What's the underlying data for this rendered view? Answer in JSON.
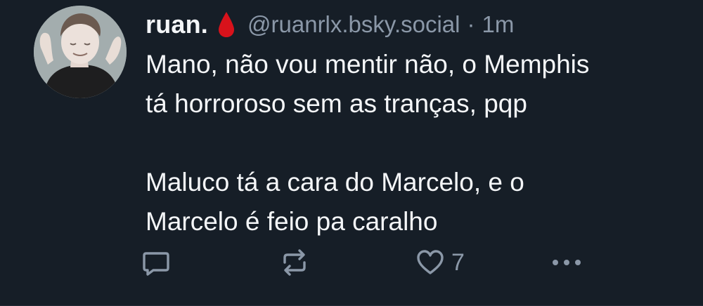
{
  "post": {
    "author": {
      "display_name": "ruan.",
      "handle": "@ruanrlx.bsky.social",
      "badge_icon": "blood-drop-icon",
      "badge_color": "#d8121b"
    },
    "separator": "·",
    "timestamp": "1m",
    "text": {
      "paragraph_1": "Mano, não vou mentir não, o Memphis\ntá horroroso sem as tranças, pqp",
      "paragraph_2": "Maluco tá a cara do Marcelo, e o\nMarcelo é feio pa caralho"
    },
    "actions": {
      "reply_icon": "reply-icon",
      "repost_icon": "repost-icon",
      "like_icon": "heart-icon",
      "like_count": "7",
      "more_icon": "more-options-icon"
    }
  },
  "colors": {
    "background": "#161e27",
    "text_primary": "#f4f6f8",
    "text_secondary": "#8b98a8"
  }
}
